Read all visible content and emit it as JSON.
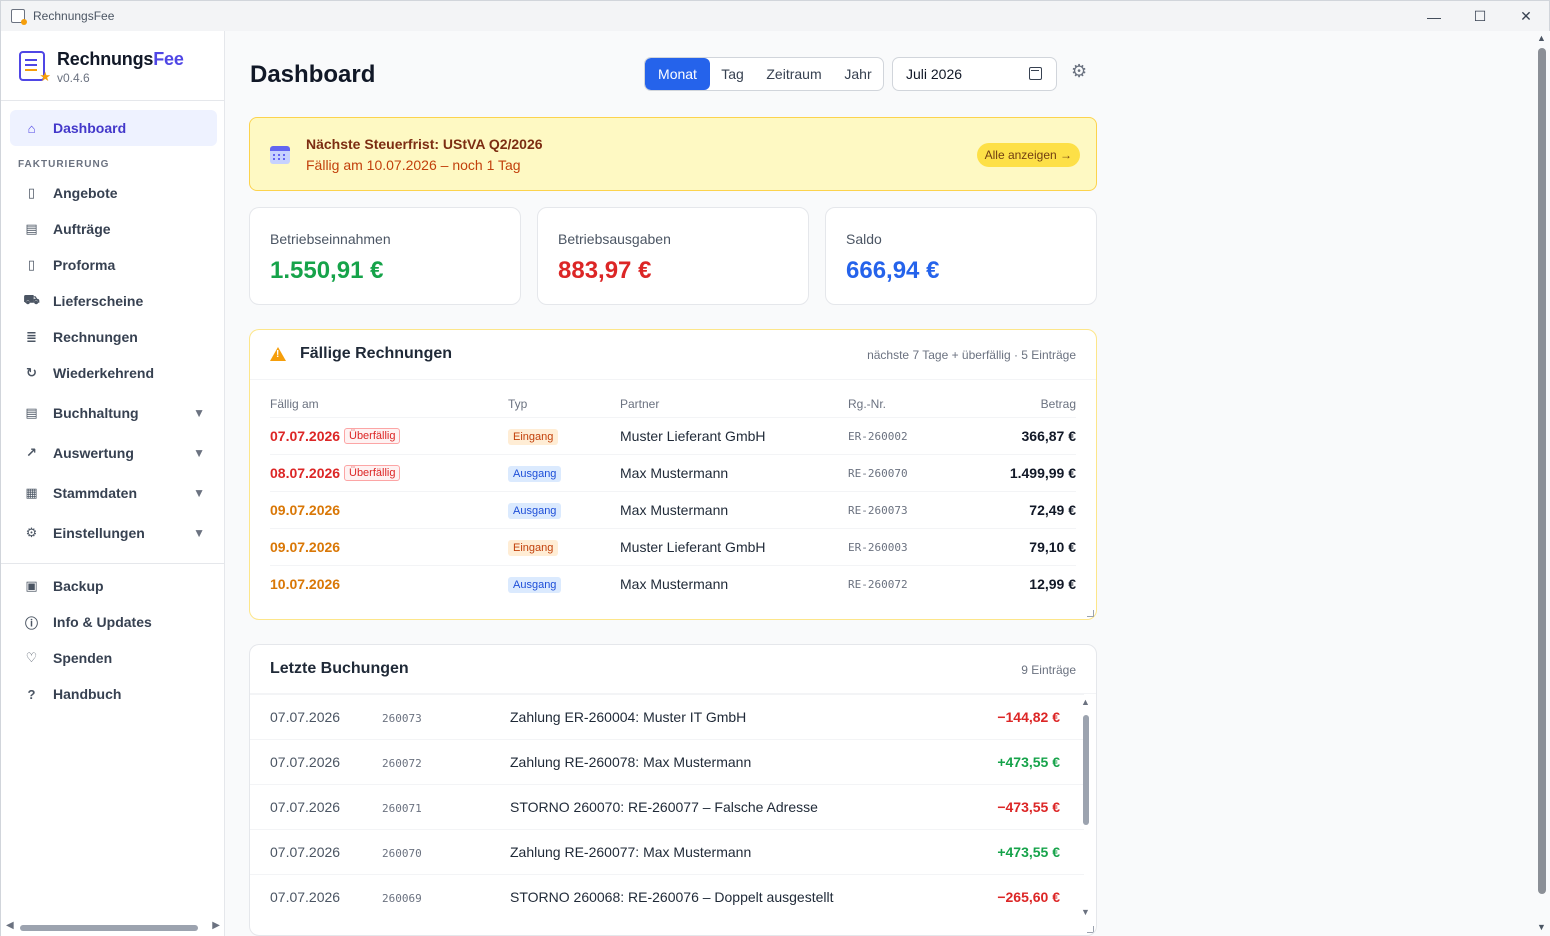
{
  "window": {
    "title": "RechnungsFee",
    "minimize": "—",
    "maximize": "☐",
    "close": "✕"
  },
  "brand": {
    "name_a": "Rechnungs",
    "name_b": "Fee",
    "version": "v0.4.6"
  },
  "sidebar": {
    "dashboard": "Dashboard",
    "section_fakturierung": "FAKTURIERUNG",
    "items": [
      {
        "label": "Angebote",
        "icon": "document-icon"
      },
      {
        "label": "Aufträge",
        "icon": "clipboard-icon"
      },
      {
        "label": "Proforma",
        "icon": "file-icon"
      },
      {
        "label": "Lieferscheine",
        "icon": "truck-icon"
      },
      {
        "label": "Rechnungen",
        "icon": "invoice-icon"
      },
      {
        "label": "Wiederkehrend",
        "icon": "repeat-icon"
      }
    ],
    "groups": [
      {
        "label": "Buchhaltung",
        "icon": "folder-icon"
      },
      {
        "label": "Auswertung",
        "icon": "trending-icon"
      },
      {
        "label": "Stammdaten",
        "icon": "database-icon"
      },
      {
        "label": "Einstellungen",
        "icon": "gear-icon"
      }
    ],
    "bottom": [
      {
        "label": "Backup",
        "icon": "save-icon"
      },
      {
        "label": "Info & Updates",
        "icon": "info-icon"
      },
      {
        "label": "Spenden",
        "icon": "donate-icon"
      },
      {
        "label": "Handbuch",
        "icon": "help-icon"
      }
    ]
  },
  "header": {
    "title": "Dashboard",
    "segments": [
      "Monat",
      "Tag",
      "Zeitraum",
      "Jahr"
    ],
    "active_segment": "Monat",
    "period_value": "Juli 2026"
  },
  "alert": {
    "title": "Nächste Steuerfrist: UStVA Q2/2026",
    "subtitle": "Fällig am 10.07.2026 – noch 1 Tag",
    "button": "Alle anzeigen →"
  },
  "kpis": [
    {
      "label": "Betriebseinnahmen",
      "value": "1.550,91 €",
      "color": "#16a34a"
    },
    {
      "label": "Betriebsausgaben",
      "value": "883,97 €",
      "color": "#dc2626"
    },
    {
      "label": "Saldo",
      "value": "666,94 €",
      "color": "#2563eb"
    }
  ],
  "due": {
    "title": "Fällige Rechnungen",
    "meta": "nächste 7 Tage + überfällig · 5 Einträge",
    "columns": [
      "Fällig am",
      "Typ",
      "Partner",
      "Rg.-Nr.",
      "Betrag"
    ],
    "overdue_label": "Überfällig",
    "rows": [
      {
        "date": "07.07.2026",
        "overdue": true,
        "type": "Eingang",
        "partner": "Muster Lieferant GmbH",
        "nr": "ER-260002",
        "amount": "366,87 €"
      },
      {
        "date": "08.07.2026",
        "overdue": true,
        "type": "Ausgang",
        "partner": "Max Mustermann",
        "nr": "RE-260070",
        "amount": "1.499,99 €"
      },
      {
        "date": "09.07.2026",
        "overdue": false,
        "type": "Ausgang",
        "partner": "Max Mustermann",
        "nr": "RE-260073",
        "amount": "72,49 €"
      },
      {
        "date": "09.07.2026",
        "overdue": false,
        "type": "Eingang",
        "partner": "Muster Lieferant GmbH",
        "nr": "ER-260003",
        "amount": "79,10 €"
      },
      {
        "date": "10.07.2026",
        "overdue": false,
        "type": "Ausgang",
        "partner": "Max Mustermann",
        "nr": "RE-260072",
        "amount": "12,99 €"
      }
    ]
  },
  "bookings": {
    "title": "Letzte Buchungen",
    "meta": "9 Einträge",
    "rows": [
      {
        "date": "07.07.2026",
        "nr": "260073",
        "text": "Zahlung ER-260004: Muster IT GmbH",
        "amount": "−144,82 €",
        "sign": "neg"
      },
      {
        "date": "07.07.2026",
        "nr": "260072",
        "text": "Zahlung RE-260078: Max Mustermann",
        "amount": "+473,55 €",
        "sign": "pos"
      },
      {
        "date": "07.07.2026",
        "nr": "260071",
        "text": "STORNO 260070: RE-260077 – Falsche Adresse",
        "amount": "−473,55 €",
        "sign": "neg"
      },
      {
        "date": "07.07.2026",
        "nr": "260070",
        "text": "Zahlung RE-260077: Max Mustermann",
        "amount": "+473,55 €",
        "sign": "pos"
      },
      {
        "date": "07.07.2026",
        "nr": "260069",
        "text": "STORNO 260068: RE-260076 – Doppelt ausgestellt",
        "amount": "−265,60 €",
        "sign": "neg"
      }
    ]
  }
}
